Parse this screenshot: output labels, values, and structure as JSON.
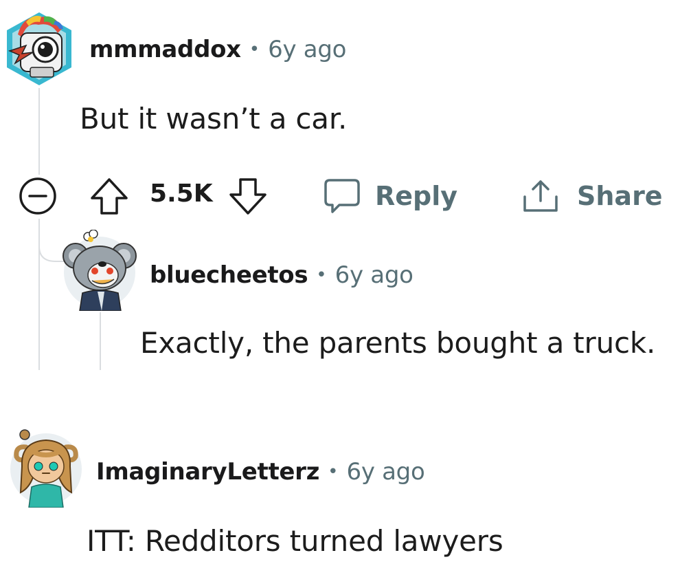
{
  "comments": [
    {
      "username": "mmmaddox",
      "separator": "•",
      "age": "6y ago",
      "body": "But it wasn’t a car.",
      "avatar_icon": "robot-avatar-icon",
      "actions": {
        "collapse_icon": "collapse-minus-icon",
        "upvote_icon": "upvote-arrow-icon",
        "score": "5.5K",
        "downvote_icon": "downvote-arrow-icon",
        "reply_icon": "speech-bubble-icon",
        "reply_label": "Reply",
        "share_icon": "share-upload-icon",
        "share_label": "Share"
      },
      "replies": [
        {
          "username": "bluecheetos",
          "separator": "•",
          "age": "6y ago",
          "body": "Exactly, the parents bought a truck.",
          "avatar_icon": "koala-avatar-icon"
        }
      ]
    },
    {
      "username": "ImaginaryLetterz",
      "separator": "•",
      "age": "6y ago",
      "body": "ITT: Redditors turned lawyers",
      "avatar_icon": "horned-girl-avatar-icon"
    }
  ],
  "colors": {
    "thread_line": "#dadde0",
    "meta_gray": "#576f76",
    "text": "#1c1c1c"
  }
}
